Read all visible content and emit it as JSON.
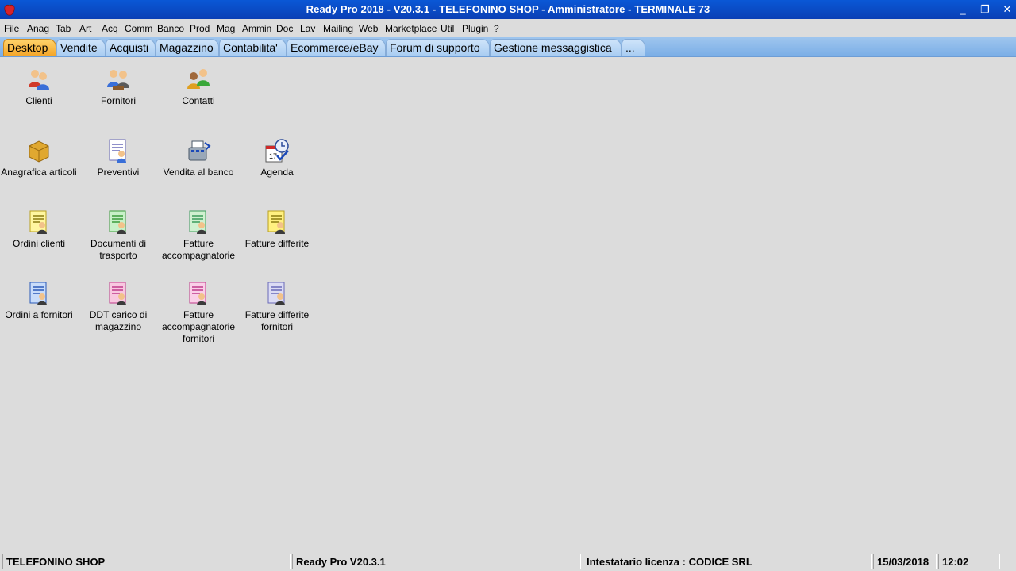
{
  "window": {
    "title": "Ready Pro 2018 - V20.3.1 - TELEFONINO SHOP - Amministratore - TERMINALE 73",
    "minimize": "_",
    "restore": "❐",
    "close": "✕"
  },
  "menu": [
    "File",
    "Anag",
    "Tab",
    "Art",
    "Acq",
    "Comm",
    "Banco",
    "Prod",
    "Mag",
    "Ammin",
    "Doc",
    "Lav",
    "Mailing",
    "Web",
    "Marketplace",
    "Util",
    "Plugin",
    "?"
  ],
  "tabs": [
    "Desktop",
    "Vendite",
    "Acquisti",
    "Magazzino",
    "Contabilita'",
    "Ecommerce/eBay",
    "Forum di supporto",
    "Gestione messaggistica",
    "..."
  ],
  "active_tab": "Desktop",
  "desktop": [
    {
      "icon": "clienti-icon",
      "label": "Clienti"
    },
    {
      "icon": "fornitori-icon",
      "label": "Fornitori"
    },
    {
      "icon": "contatti-icon",
      "label": "Contatti"
    },
    {
      "icon": "anagrafica-articoli-icon",
      "label": "Anagrafica articoli"
    },
    {
      "icon": "preventivi-icon",
      "label": "Preventivi"
    },
    {
      "icon": "vendita-al-banco-icon",
      "label": "Vendita al banco"
    },
    {
      "icon": "agenda-icon",
      "label": "Agenda"
    },
    {
      "icon": "ordini-clienti-icon",
      "label": "Ordini clienti"
    },
    {
      "icon": "documenti-di-trasporto-icon",
      "label": "Documenti di trasporto"
    },
    {
      "icon": "fatture-accompagnatorie-icon",
      "label": "Fatture accompagnatorie"
    },
    {
      "icon": "fatture-differite-icon",
      "label": "Fatture differite"
    },
    {
      "icon": "ordini-a-fornitori-icon",
      "label": "Ordini a fornitori"
    },
    {
      "icon": "ddt-carico-di-magazzino-icon",
      "label": "DDT carico di magazzino"
    },
    {
      "icon": "fatture-accompagnatorie-fornitori-icon",
      "label": "Fatture accompagnatorie fornitori"
    },
    {
      "icon": "fatture-differite-fornitori-icon",
      "label": "Fatture differite fornitori"
    }
  ],
  "status": {
    "company": "TELEFONINO SHOP",
    "version": "Ready Pro V20.3.1",
    "license": "Intestatario licenza : CODICE SRL",
    "date": "15/03/2018",
    "time": "12:02"
  },
  "colors": {
    "titlebar": "#0a4ec8",
    "tabstrip": "#8ab8ea",
    "active_tab": "#f7b035",
    "desktop": "#dcdcdc"
  }
}
